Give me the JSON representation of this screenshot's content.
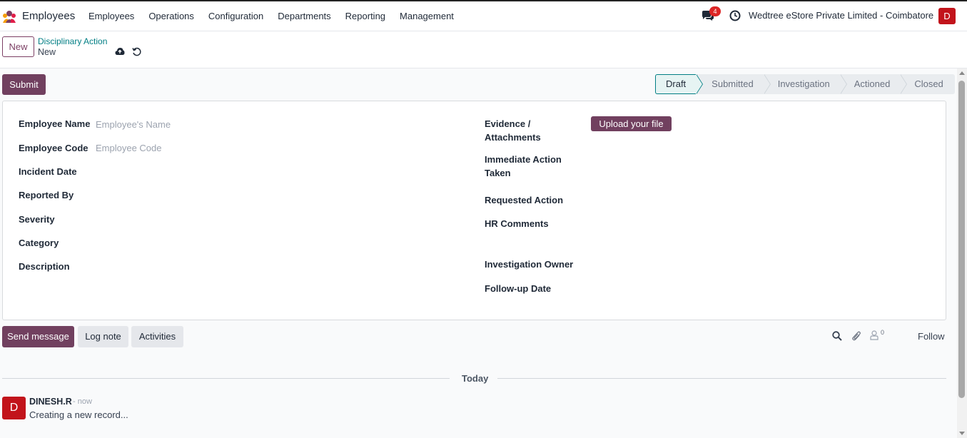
{
  "app": {
    "name": "Employees"
  },
  "menu": [
    "Employees",
    "Operations",
    "Configuration",
    "Departments",
    "Reporting",
    "Management"
  ],
  "topbar": {
    "chat_badge": "4",
    "company": "Wedtree eStore Private Limited - Coimbatore",
    "avatar_letter": "D"
  },
  "control": {
    "new_label": "New",
    "breadcrumb_parent": "Disciplinary Action",
    "breadcrumb_current": "New"
  },
  "statusbar": {
    "submit_label": "Submit",
    "stages": [
      "Draft",
      "Submitted",
      "Investigation",
      "Actioned",
      "Closed"
    ],
    "active_stage": "Draft"
  },
  "form": {
    "left": {
      "employee_name": {
        "label": "Employee Name",
        "placeholder": "Employee's Name"
      },
      "employee_code": {
        "label": "Employee Code",
        "placeholder": "Employee Code"
      },
      "incident_date": "Incident Date",
      "reported_by": "Reported By",
      "severity": "Severity",
      "category": "Category",
      "description": "Description"
    },
    "right": {
      "evidence_line1": "Evidence /",
      "evidence_line2": "Attachments",
      "upload_label": "Upload your file",
      "immediate_line1": "Immediate Action",
      "immediate_line2": "Taken",
      "requested_action": "Requested Action",
      "hr_comments": "HR Comments",
      "investigation_owner": "Investigation Owner",
      "followup_date": "Follow-up Date"
    }
  },
  "chatter": {
    "send_message": "Send message",
    "log_note": "Log note",
    "activities": "Activities",
    "follower_count": "0",
    "follow": "Follow",
    "today": "Today",
    "message": {
      "avatar_letter": "D",
      "author": "DINESH.R",
      "time": "- now",
      "body": "Creating a new record..."
    }
  },
  "colors": {
    "primary": "#71405f",
    "teal": "#017e84",
    "avatar": "#c2141b",
    "badge": "#dc2626"
  }
}
